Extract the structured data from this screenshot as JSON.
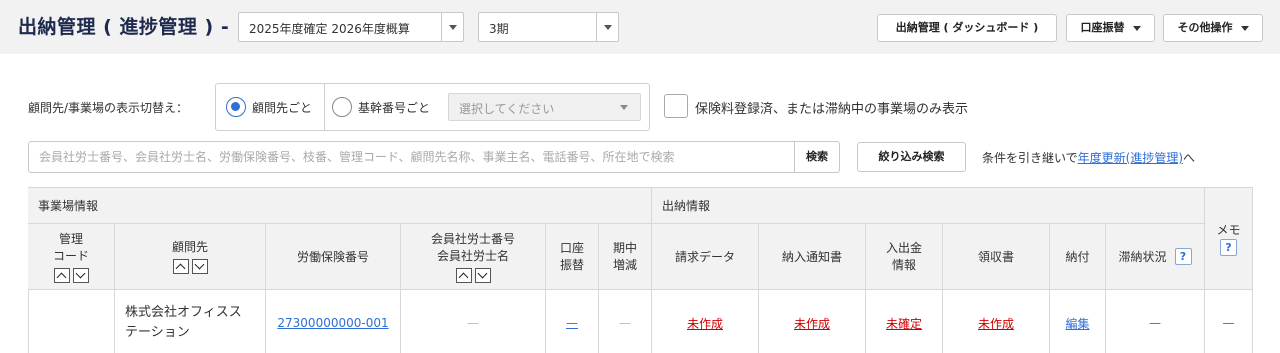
{
  "header": {
    "title": "出納管理 ( 進捗管理 ) -",
    "year_select": "2025年度確定 2026年度概算",
    "term_select": "3期",
    "dashboard_button": "出納管理 ( ダッシュボード )",
    "transfer_button": "口座振替",
    "other_button": "その他操作"
  },
  "filter": {
    "label": "顧問先/事業場の表示切替え：",
    "option_client": "顧問先ごと",
    "option_base_number": "基幹番号ごと",
    "base_number_placeholder": "選択してください",
    "checkbox_label": "保険料登録済、または滞納中の事業場のみ表示"
  },
  "search": {
    "placeholder": "会員社労士番号、会員社労士名、労働保険番号、枝番、管理コード、顧問先名称、事業主名、電話番号、所在地で検索",
    "search_button": "検索",
    "narrow_button": "絞り込み検索",
    "carry_text": "条件を引き継いで",
    "carry_link": "年度更新(進捗管理)",
    "carry_suffix": "へ"
  },
  "table": {
    "group_site": "事業場情報",
    "group_payment": "出納情報",
    "headers": {
      "code_line1": "管理",
      "code_line2": "コード",
      "client": "顧問先",
      "insurance_no": "労働保険番号",
      "member_line1": "会員社労士番号",
      "member_line2": "会員社労士名",
      "transfer_line1": "口座",
      "transfer_line2": "振替",
      "midterm_line1": "期中",
      "midterm_line2": "増減",
      "billing": "請求データ",
      "notice": "納入通知書",
      "inout_line1": "入出金",
      "inout_line2": "情報",
      "receipt": "領収書",
      "payment": "納付",
      "arrears": "滞納状況",
      "memo": "メモ",
      "help_mark": "?"
    },
    "rows": [
      {
        "code": "",
        "client_line1": "株式会社オフィスス",
        "client_line2": "テーション",
        "insurance_no": "27300000000-001",
        "member": "—",
        "transfer": "—",
        "midterm": "—",
        "billing": "未作成",
        "notice": "未作成",
        "inout": "未確定",
        "receipt": "未作成",
        "payment": "編集",
        "arrears": "—",
        "memo": "—"
      }
    ]
  }
}
